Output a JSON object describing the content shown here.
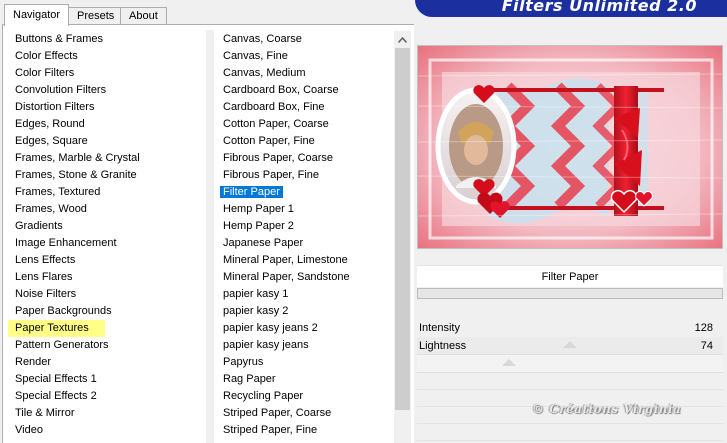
{
  "tabs": [
    {
      "label": "Navigator",
      "active": true
    },
    {
      "label": "Presets",
      "active": false
    },
    {
      "label": "About",
      "active": false
    }
  ],
  "banner": {
    "title": "Filters Unlimited 2.0"
  },
  "categories": {
    "items": [
      "Buttons & Frames",
      "Color Effects",
      "Color Filters",
      "Convolution Filters",
      "Distortion Filters",
      "Edges, Round",
      "Edges, Square",
      "Frames, Marble & Crystal",
      "Frames, Stone & Granite",
      "Frames, Textured",
      "Frames, Wood",
      "Gradients",
      "Image Enhancement",
      "Lens Effects",
      "Lens Flares",
      "Noise Filters",
      "Paper Backgrounds",
      "Paper Textures",
      "Pattern Generators",
      "Render",
      "Special Effects 1",
      "Special Effects 2",
      "Tile & Mirror",
      "Video"
    ],
    "highlighted": "Paper Textures"
  },
  "filters": {
    "items": [
      "Canvas, Coarse",
      "Canvas, Fine",
      "Canvas, Medium",
      "Cardboard Box, Coarse",
      "Cardboard Box, Fine",
      "Cotton Paper, Coarse",
      "Cotton Paper, Fine",
      "Fibrous Paper, Coarse",
      "Fibrous Paper, Fine",
      "Filter Paper",
      "Hemp Paper 1",
      "Hemp Paper 2",
      "Japanese Paper",
      "Mineral Paper, Limestone",
      "Mineral Paper, Sandstone",
      "papier kasy 1",
      "papier kasy 2",
      "papier kasy jeans 2",
      "papier kasy jeans",
      "Papyrus",
      "Rag Paper",
      "Recycling Paper",
      "Striped Paper, Coarse",
      "Striped Paper, Fine"
    ],
    "selected": "Filter Paper"
  },
  "panel": {
    "filter_name": "Filter Paper",
    "params": [
      {
        "label": "Intensity",
        "value": "128",
        "fraction": 0.5
      },
      {
        "label": "Lightness",
        "value": "74",
        "fraction": 0.29
      }
    ]
  },
  "watermark": "© Créations Virginia",
  "colors": {
    "selection": "#0078d7",
    "highlight": "#ffff88",
    "banner": "#1b2f9e"
  }
}
